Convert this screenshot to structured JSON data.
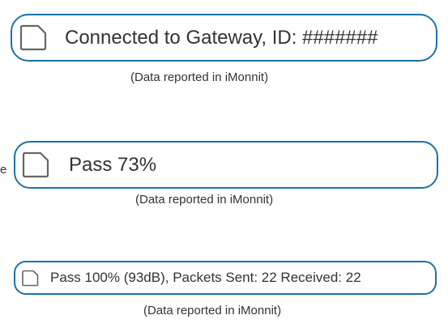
{
  "colors": {
    "border": "#1a73a8",
    "text": "#333333",
    "icon_stroke": "#666666"
  },
  "rows": [
    {
      "message": "Connected to Gateway, ID: #######",
      "caption": "(Data reported in iMonnit)",
      "icon": "document-icon"
    },
    {
      "message": "Pass 73%",
      "caption": "(Data reported in iMonnit)",
      "icon": "document-icon"
    },
    {
      "message": "Pass 100% (93dB), Packets Sent: 22 Received: 22",
      "caption": "(Data reported in iMonnit)",
      "icon": "document-icon"
    }
  ],
  "edge_text": "e"
}
